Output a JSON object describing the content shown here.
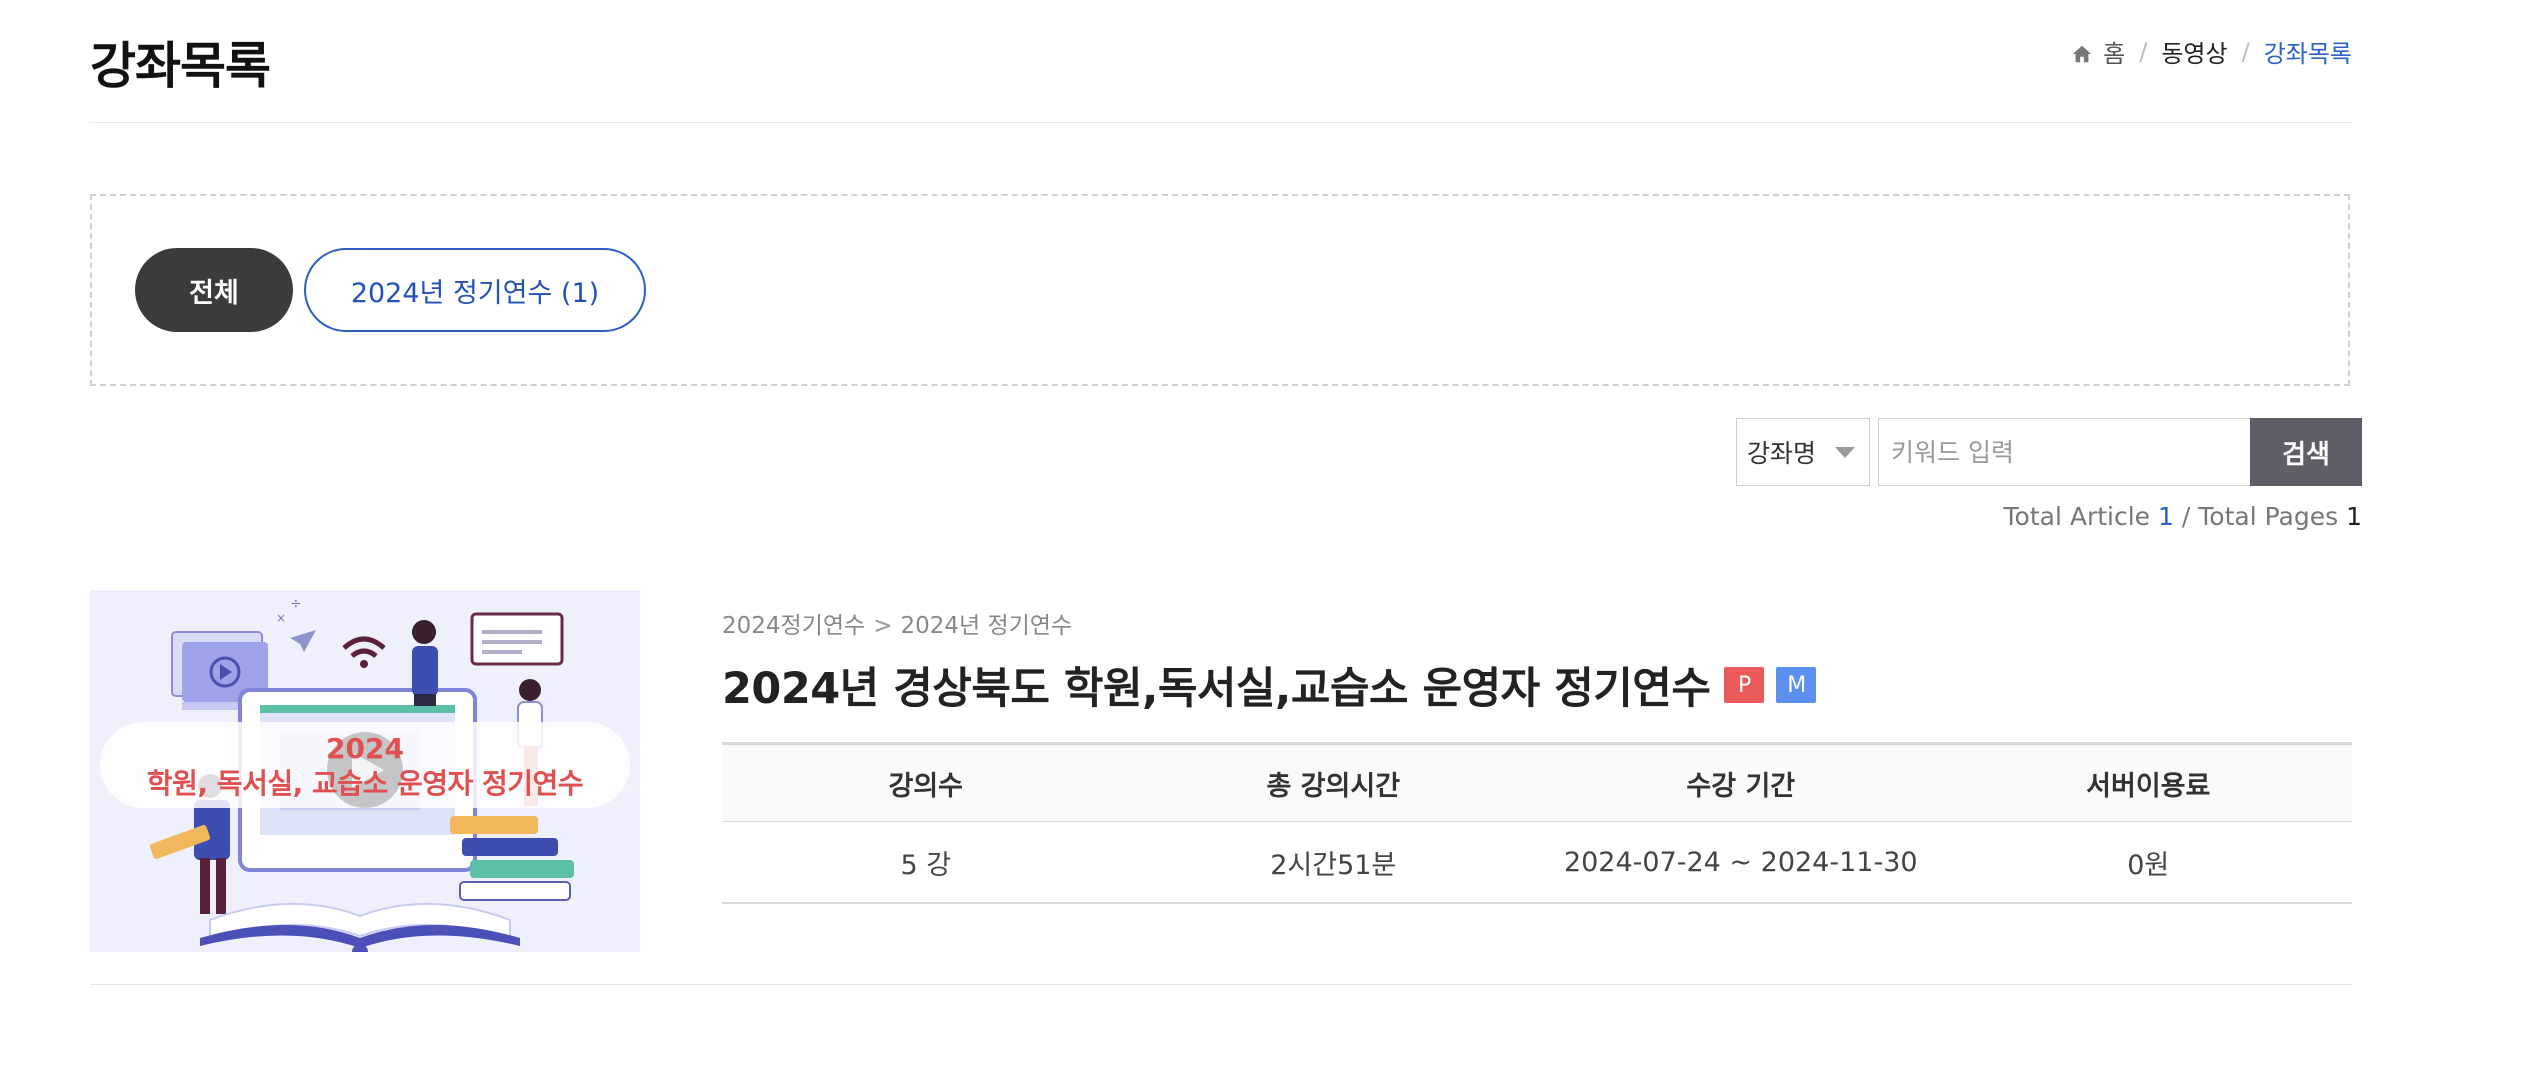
{
  "header": {
    "title": "강좌목록",
    "breadcrumb": [
      "홈",
      "동영상",
      "강좌목록"
    ],
    "separator": "/"
  },
  "filters": {
    "all_label": "전체",
    "category_label": "2024년 정기연수 (1)"
  },
  "search": {
    "select_value": "강좌명",
    "placeholder": "키워드 입력",
    "button_label": "검색"
  },
  "totals": {
    "article_label": "Total Article",
    "article_count": "1",
    "pages_label": "/ Total Pages",
    "pages_count": "1"
  },
  "course": {
    "path": [
      "2024정기연수",
      "2024년 정기연수"
    ],
    "title": "2024년 경상북도 학원,독서실,교습소 운영자 정기연수",
    "badges": [
      "P",
      "M"
    ],
    "thumbnail": {
      "year": "2024",
      "text": "학원, 독서실, 교습소 운영자 정기연수"
    },
    "table": {
      "headers": [
        "강의수",
        "총 강의시간",
        "수강 기간",
        "서버이용료"
      ],
      "values": [
        "5 강",
        "2시간51분",
        "2024-07-24 ~ 2024-11-30",
        "0원"
      ]
    }
  },
  "colors": {
    "accent_blue": "#2b62c5",
    "pill_dark": "#3b3b3b",
    "search_button": "#5c5f66",
    "badge_p": "#ea5a5a",
    "badge_m": "#5b8ff0"
  }
}
